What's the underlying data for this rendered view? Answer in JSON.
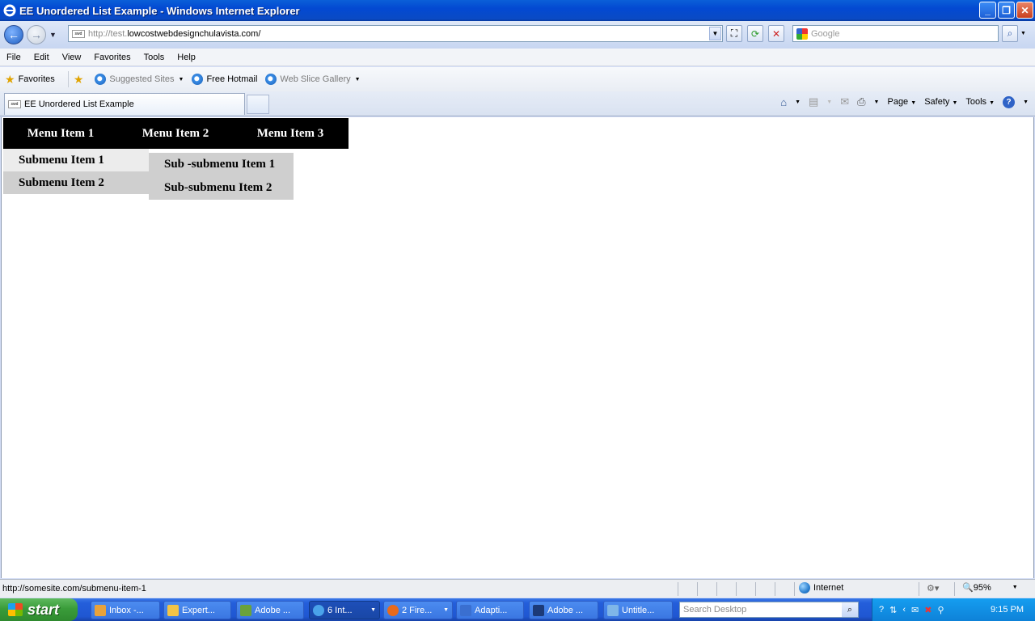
{
  "window": {
    "title": "EE Unordered List Example - Windows Internet Explorer"
  },
  "address": {
    "url_proto": "http://test.",
    "url_rest": "lowcostwebdesignchulavista.com/",
    "favicon_text": "swd"
  },
  "search": {
    "placeholder": "Google"
  },
  "menubar": {
    "file": "File",
    "edit": "Edit",
    "view": "View",
    "favorites": "Favorites",
    "tools": "Tools",
    "help": "Help"
  },
  "favbar": {
    "favorites": "Favorites",
    "suggested": "Suggested Sites",
    "hotmail": "Free Hotmail",
    "webslice": "Web Slice Gallery"
  },
  "tab": {
    "title": "EE Unordered List Example"
  },
  "cmdbar": {
    "page": "Page",
    "safety": "Safety",
    "tools": "Tools"
  },
  "content": {
    "menu": [
      "Menu Item 1",
      "Menu Item 2",
      "Menu Item 3"
    ],
    "submenu": [
      "Submenu Item 1",
      "Submenu Item 2"
    ],
    "subsubmenu": [
      "Sub -submenu Item 1",
      "Sub-submenu Item 2"
    ]
  },
  "status": {
    "text": "http://somesite.com/submenu-item-1",
    "zone": "Internet",
    "zoom": "95%"
  },
  "taskbar": {
    "start": "start",
    "items": [
      "Inbox -...",
      "Expert...",
      "Adobe ...",
      "6 Int...",
      "2 Fire...",
      "Adapti...",
      "Adobe ...",
      "Untitle..."
    ],
    "search_placeholder": "Search Desktop",
    "clock": "9:15 PM"
  }
}
